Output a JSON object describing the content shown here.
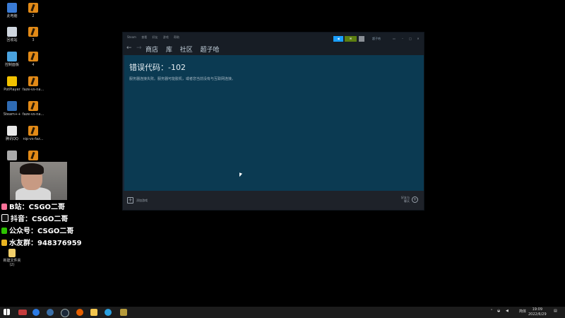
{
  "desktop": {
    "icons_left": [
      {
        "label": "此电脑",
        "icon": "computer-icon",
        "color": "#3a7bd5"
      },
      {
        "label": "回收站",
        "icon": "recycle-bin-icon",
        "color": "#cfd6de"
      },
      {
        "label": "控制面板",
        "icon": "control-panel-icon",
        "color": "#4aa3df"
      },
      {
        "label": "PotPlayer",
        "icon": "potplayer-icon",
        "color": "#f2c200"
      },
      {
        "label": "Steam++",
        "icon": "steam-plus-icon",
        "color": "#2f6bb3"
      },
      {
        "label": "腾讯QQ",
        "icon": "qq-icon",
        "color": "#e8e8e8"
      },
      {
        "label": "",
        "icon": "app-icon",
        "color": "#aaaaaa"
      }
    ],
    "icons_right": [
      {
        "label": "2"
      },
      {
        "label": "3"
      },
      {
        "label": "4"
      },
      {
        "label": "faze-vs-na..."
      },
      {
        "label": "faze-vs-na..."
      },
      {
        "label": "nip-vs-faz..."
      },
      {
        "label": ""
      }
    ],
    "icon_bottom": {
      "label_line1": "新建文件夹",
      "label_line2": "(2)"
    }
  },
  "steam": {
    "menu": [
      "Steam",
      "查看",
      "好友",
      "游戏",
      "帮助"
    ],
    "user_name": "超子哈",
    "nav_links": [
      "商店",
      "库",
      "社区",
      "超子哈"
    ],
    "error_title": "错误代码：-102",
    "error_message": "服务器连接失败。服务器可能脱机，或者您当前没有与互联网连接。",
    "add_game_label": "添加游戏",
    "friends_label_line1": "好友与",
    "friends_label_line2": "聊天"
  },
  "stream_overlay": {
    "lines": [
      {
        "text": "B站：CSGO二哥",
        "icon": "bilibili-icon",
        "color": "#fb7299"
      },
      {
        "text": "抖音：CSGO二哥",
        "icon": "douyin-icon",
        "color": "#111111"
      },
      {
        "text": "公众号：CSGO二哥",
        "icon": "wechat-icon",
        "color": "#2dc100"
      },
      {
        "text": "水友群：948376959",
        "icon": "group-icon",
        "color": "#e9b420"
      }
    ]
  },
  "taskbar": {
    "apps": [
      "windows-start-icon",
      "task-view-icon",
      "browser-icon",
      "steam-icon",
      "firefox-icon",
      "file-explorer-icon",
      "app-icon",
      "csgo-icon"
    ],
    "ime": "简体",
    "time": "19:09",
    "date": "2022/6/29"
  }
}
